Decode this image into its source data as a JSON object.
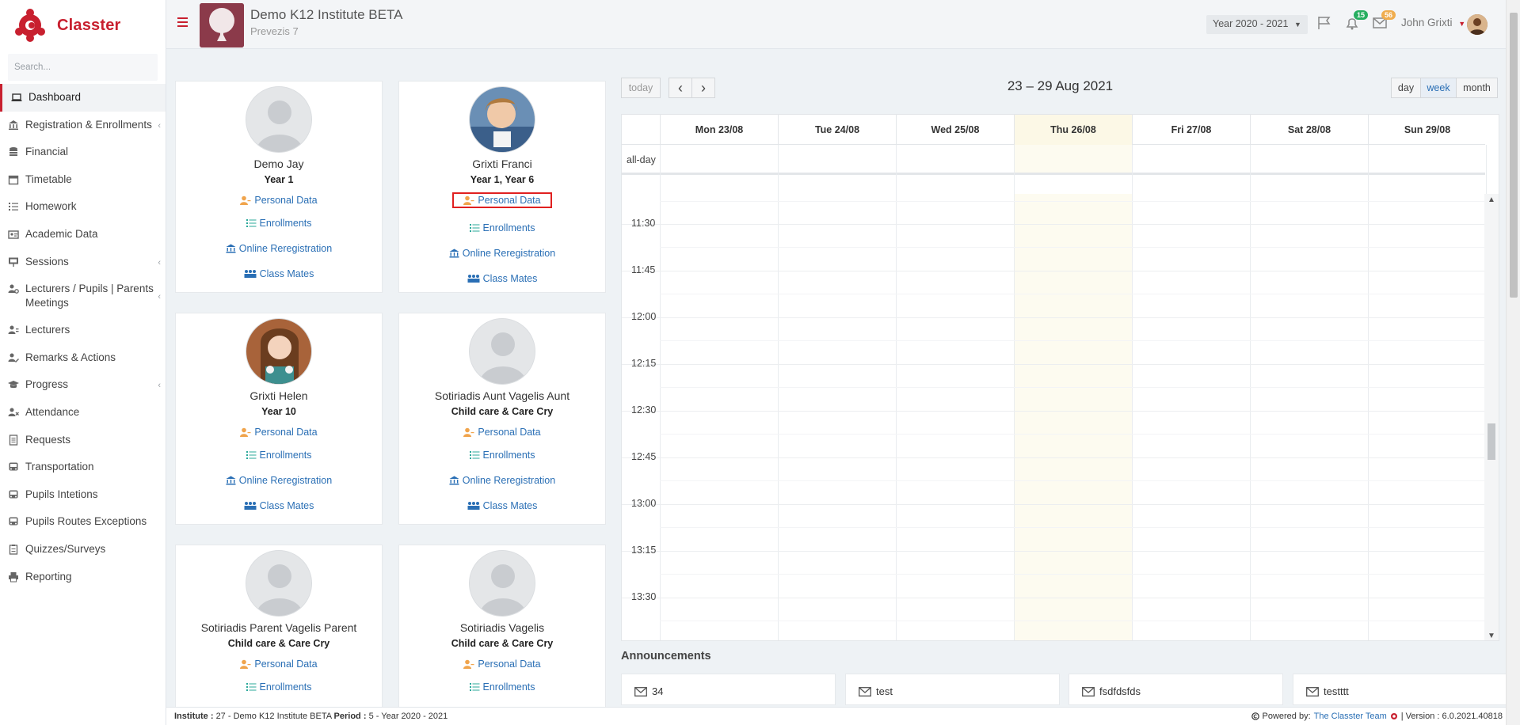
{
  "brand": {
    "name": "Classter",
    "color": "#c8202f"
  },
  "sidebar": {
    "search_placeholder": "Search...",
    "items": [
      {
        "label": "Dashboard",
        "icon": "laptop-icon",
        "active": true,
        "chevron": false
      },
      {
        "label": "Registration & Enrollments",
        "icon": "institution-icon",
        "chevron": true
      },
      {
        "label": "Financial",
        "icon": "coins-icon",
        "chevron": false
      },
      {
        "label": "Timetable",
        "icon": "calendar-icon",
        "chevron": false
      },
      {
        "label": "Homework",
        "icon": "list-check-icon",
        "chevron": false
      },
      {
        "label": "Academic Data",
        "icon": "id-card-icon",
        "chevron": false
      },
      {
        "label": "Sessions",
        "icon": "presentation-icon",
        "chevron": true
      },
      {
        "label": "Lecturers / Pupils | Parents Meetings",
        "icon": "users-gear-icon",
        "chevron": true
      },
      {
        "label": "Lecturers",
        "icon": "user-group-icon",
        "chevron": false
      },
      {
        "label": "Remarks & Actions",
        "icon": "user-edit-icon",
        "chevron": false
      },
      {
        "label": "Progress",
        "icon": "graduation-cap-icon",
        "chevron": true
      },
      {
        "label": "Attendance",
        "icon": "user-times-icon",
        "chevron": false
      },
      {
        "label": "Requests",
        "icon": "document-icon",
        "chevron": false
      },
      {
        "label": "Transportation",
        "icon": "bus-icon",
        "chevron": false
      },
      {
        "label": "Pupils Intetions",
        "icon": "bus-icon",
        "chevron": false
      },
      {
        "label": "Pupils Routes Exceptions",
        "icon": "bus-icon",
        "chevron": false
      },
      {
        "label": "Quizzes/Surveys",
        "icon": "clipboard-icon",
        "chevron": false
      },
      {
        "label": "Reporting",
        "icon": "printer-icon",
        "chevron": false
      }
    ]
  },
  "header": {
    "institute_name": "Demo K12 Institute BETA",
    "institute_location": "Prevezis 7",
    "year_select": "Year 2020 - 2021",
    "notifications_count": "15",
    "messages_count": "56",
    "user_name": "John Grixti"
  },
  "links": {
    "personal_data": "Personal Data",
    "enrollments": "Enrollments",
    "online_reregistration": "Online Reregistration",
    "class_mates": "Class Mates"
  },
  "pupils": [
    {
      "name": "Demo Jay",
      "year": "Year 1",
      "photo": "placeholder"
    },
    {
      "name": "Grixti Franci",
      "year": "Year 1, Year 6",
      "photo": "boy-photo"
    },
    {
      "name": "Grixti Helen",
      "year": "Year 10",
      "photo": "girl-photo"
    },
    {
      "name": "Sotiriadis Aunt Vagelis Aunt",
      "year": "Child care & Care Cry",
      "photo": "placeholder"
    },
    {
      "name": "Sotiriadis Parent Vagelis Parent",
      "year": "Child care & Care Cry",
      "photo": "placeholder"
    },
    {
      "name": "Sotiriadis Vagelis",
      "year": "Child care & Care Cry",
      "photo": "placeholder"
    }
  ],
  "calendar": {
    "today_label": "today",
    "prev_label": "‹",
    "next_label": "›",
    "range_title": "23 – 29 Aug 2021",
    "views": [
      "day",
      "week",
      "month"
    ],
    "active_view": "week",
    "days": [
      "Mon 23/08",
      "Tue 24/08",
      "Wed 25/08",
      "Thu 26/08",
      "Fri 27/08",
      "Sat 28/08",
      "Sun 29/08"
    ],
    "today_day": "Thu 26/08",
    "allday_label": "all-day",
    "times": [
      "11:30",
      "11:45",
      "12:00",
      "12:15",
      "12:30",
      "12:45",
      "13:00",
      "13:15",
      "13:30"
    ]
  },
  "announcements": {
    "title": "Announcements",
    "items": [
      "34",
      "test",
      "fsdfdsfds",
      "testttt"
    ]
  },
  "footer": {
    "institute_label": "Institute :",
    "institute_value": "27 - Demo K12 Institute BETA",
    "period_label": "Period :",
    "period_value": "5 - Year 2020 - 2021",
    "powered_label": "Powered by:",
    "powered_team": "The Classter Team",
    "version_label": "| Version : 6.0.2021.40818"
  },
  "colors": {
    "accent": "#c8202f",
    "link": "#2a6fb5",
    "today_bg": "#fcf8e6",
    "highlight": "#e02020"
  }
}
